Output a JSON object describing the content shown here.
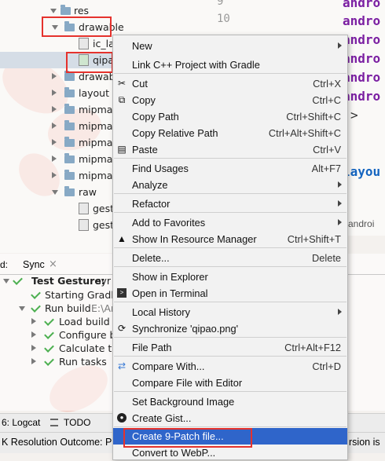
{
  "tree": {
    "items": [
      {
        "label": "res"
      },
      {
        "label": "drawable"
      },
      {
        "label": "ic_la"
      },
      {
        "label": "qipa"
      },
      {
        "label": "drawab"
      },
      {
        "label": "layout"
      },
      {
        "label": "mipmap"
      },
      {
        "label": "mipmap"
      },
      {
        "label": "mipmap"
      },
      {
        "label": "mipmap"
      },
      {
        "label": "mipmap"
      },
      {
        "label": "raw"
      },
      {
        "label": "gest"
      },
      {
        "label": "gest"
      }
    ]
  },
  "editor": {
    "line_numbers": [
      "9",
      "10"
    ],
    "code_lines": [
      "andro",
      "andro",
      "andro",
      "andro",
      "andro",
      "andro",
      ">",
      "layou",
      "androi"
    ]
  },
  "bottom_panel": {
    "tabs": [
      "d:",
      "Sync"
    ],
    "tab_close": "×",
    "build": [
      {
        "label": "Test Gesture:",
        "extra": "syr"
      },
      {
        "label": "Starting Gradle"
      },
      {
        "label": "Run build",
        "extra": "E:\\Ar"
      },
      {
        "label": "Load build"
      },
      {
        "label": "Configure b"
      },
      {
        "label": "Calculate ta"
      },
      {
        "label": "Run tasks"
      }
    ]
  },
  "statusbar": {
    "logcat": "6: Logcat",
    "todo": "TODO",
    "message": "K Resolution Outcome: P",
    "message_right": "rsion is"
  },
  "context_menu": {
    "items": [
      {
        "label": "New",
        "shortcut": "",
        "submenu": true
      },
      {
        "label": "Link C++ Project with Gradle",
        "shortcut": ""
      },
      {
        "label": "Cut",
        "shortcut": "Ctrl+X",
        "icon": "scissors-icon"
      },
      {
        "label": "Copy",
        "shortcut": "Ctrl+C",
        "icon": "copy-icon"
      },
      {
        "label": "Copy Path",
        "shortcut": "Ctrl+Shift+C"
      },
      {
        "label": "Copy Relative Path",
        "shortcut": "Ctrl+Alt+Shift+C"
      },
      {
        "label": "Paste",
        "shortcut": "Ctrl+V",
        "icon": "clipboard-icon"
      },
      {
        "label": "Find Usages",
        "shortcut": "Alt+F7"
      },
      {
        "label": "Analyze",
        "shortcut": "",
        "submenu": true
      },
      {
        "label": "Refactor",
        "shortcut": "",
        "submenu": true
      },
      {
        "label": "Add to Favorites",
        "shortcut": "",
        "submenu": true
      },
      {
        "label": "Show In Resource Manager",
        "shortcut": "Ctrl+Shift+T",
        "icon": "resource-manager-icon"
      },
      {
        "label": "Delete...",
        "shortcut": "Delete"
      },
      {
        "label": "Show in Explorer",
        "shortcut": ""
      },
      {
        "label": "Open in Terminal",
        "shortcut": "",
        "icon": "terminal-icon"
      },
      {
        "label": "Local History",
        "shortcut": "",
        "submenu": true
      },
      {
        "label": "Synchronize 'qipao.png'",
        "shortcut": "",
        "icon": "sync-icon"
      },
      {
        "label": "File Path",
        "shortcut": "Ctrl+Alt+F12"
      },
      {
        "label": "Compare With...",
        "shortcut": "Ctrl+D",
        "icon": "compare-icon"
      },
      {
        "label": "Compare File with Editor",
        "shortcut": ""
      },
      {
        "label": "Set Background Image",
        "shortcut": ""
      },
      {
        "label": "Create Gist...",
        "shortcut": "",
        "icon": "github-icon"
      },
      {
        "label": "Create 9-Patch file...",
        "shortcut": ""
      },
      {
        "label": "Convert to WebP...",
        "shortcut": ""
      }
    ]
  },
  "colors": {
    "highlight": "#2f65ca",
    "annotation_red": "#e5322d",
    "code_purple": "#7b1fa2"
  }
}
